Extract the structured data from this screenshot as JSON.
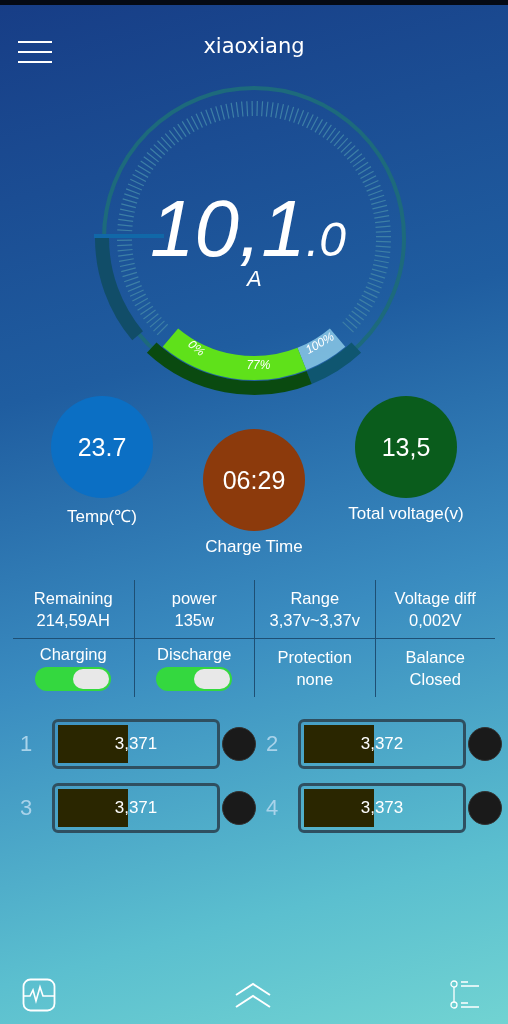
{
  "header": {
    "title": "xiaoxiang"
  },
  "gauge": {
    "value_main": "10,1",
    "value_decimal": ".0",
    "unit": "A",
    "soc": {
      "label_min": "0%",
      "label_value": "77%",
      "label_max": "100%"
    }
  },
  "readings": [
    {
      "value": "23.7",
      "label": "Temp(℃)",
      "color": "#0b6fc4"
    },
    {
      "value": "06:29",
      "label": "Charge Time",
      "color": "#8c3a0c"
    },
    {
      "value": "13,5",
      "label": "Total voltage(v)",
      "color": "#0a5c1c"
    }
  ],
  "stats": [
    {
      "kind": "text",
      "label": "Remaining",
      "value": "214,59AH"
    },
    {
      "kind": "text",
      "label": "power",
      "value": "135w"
    },
    {
      "kind": "text",
      "label": "Range",
      "value": "3,37v~3,37v"
    },
    {
      "kind": "text",
      "label": "Voltage diff",
      "value": "0,002V"
    },
    {
      "kind": "toggle",
      "label": "Charging",
      "on": true
    },
    {
      "kind": "toggle",
      "label": "Discharge",
      "on": true
    },
    {
      "kind": "text",
      "label": "Protection",
      "value": "none"
    },
    {
      "kind": "text",
      "label": "Balance",
      "value": "Closed"
    }
  ],
  "cells": [
    {
      "index": "1",
      "voltage": "3,371",
      "level": 0.43,
      "balancing": false
    },
    {
      "index": "2",
      "voltage": "3,372",
      "level": 0.43,
      "balancing": false
    },
    {
      "index": "3",
      "voltage": "3,371",
      "level": 0.43,
      "balancing": false
    },
    {
      "index": "4",
      "voltage": "3,373",
      "level": 0.43,
      "balancing": false
    }
  ]
}
